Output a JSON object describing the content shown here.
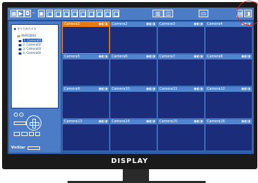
{
  "tree": {
    "root": "すべてのカメラ",
    "recorder": "NVRCB001",
    "cameras": [
      "1. Camera01",
      "2. Camera02",
      "3. Camera03",
      "4. Camera04"
    ]
  },
  "cameras": [
    {
      "label": "Camera1"
    },
    {
      "label": "Camera2"
    },
    {
      "label": "Camera3"
    },
    {
      "label": "Camera4"
    },
    {
      "label": "Camera5"
    },
    {
      "label": "Camera6"
    },
    {
      "label": "Camera7"
    },
    {
      "label": "Camera8"
    },
    {
      "label": "Camera9"
    },
    {
      "label": "Camera10"
    },
    {
      "label": "Camera11"
    },
    {
      "label": "Camera12"
    },
    {
      "label": "Camera13"
    },
    {
      "label": "Camera14"
    },
    {
      "label": "Camera15"
    },
    {
      "label": "Camera16"
    }
  ],
  "selected_camera": "Camera1",
  "brand": "VivStar",
  "display_label": "DISPLAY",
  "colors": {
    "screen": "#2f5ea8",
    "camera_tile": "#1b2c7a",
    "selected_accent": "#e67a10",
    "highlight_circle": "#e02020"
  }
}
